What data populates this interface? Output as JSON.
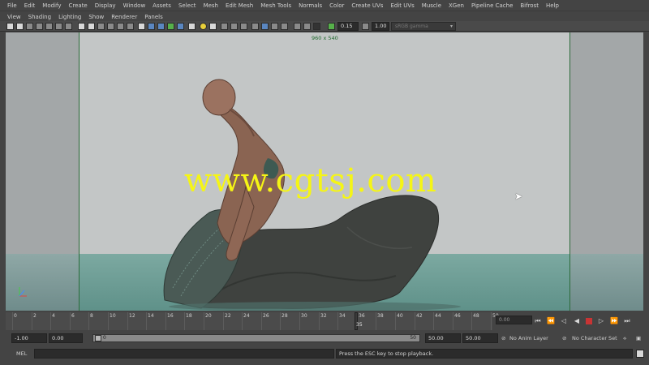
{
  "menus": [
    "File",
    "Edit",
    "Modify",
    "Create",
    "Display",
    "Window",
    "Assets",
    "Select",
    "Mesh",
    "Edit Mesh",
    "Mesh Tools",
    "Normals",
    "Color",
    "Create UVs",
    "Edit UVs",
    "Muscle",
    "XGen",
    "Pipeline Cache",
    "Bifrost",
    "Help"
  ],
  "panel_menus": [
    "View",
    "Shading",
    "Lighting",
    "Show",
    "Renderer",
    "Panels"
  ],
  "iconbar": {
    "field_a": "0.15",
    "field_b": "1.00",
    "colorspace": "sRGB gamma"
  },
  "viewport": {
    "resolution_label": "960 x 540",
    "watermark": "www.cgtsj.com",
    "colors": {
      "gate_border": "#2c6b3a",
      "watermark": "#f5f515",
      "background": "#c3c6c6",
      "water": "#7ca9a1"
    }
  },
  "timeslider": {
    "tick_labels": [
      "0",
      "2",
      "4",
      "6",
      "8",
      "10",
      "12",
      "14",
      "16",
      "18",
      "20",
      "22",
      "24",
      "26",
      "28",
      "30",
      "32",
      "34",
      "36",
      "38",
      "40",
      "42",
      "44",
      "46",
      "48",
      "50"
    ],
    "current_frame": "35",
    "current_frame_field": "0.00"
  },
  "range": {
    "start_time": "-1.00",
    "playback_start": "0.00",
    "slider_start": "0",
    "slider_end": "50",
    "playback_end": "50.00",
    "end_time": "50.00",
    "anim_layer": "No Anim Layer",
    "character_set": "No Character Set"
  },
  "command": {
    "language": "MEL",
    "result": "Press the ESC key to stop playback."
  }
}
